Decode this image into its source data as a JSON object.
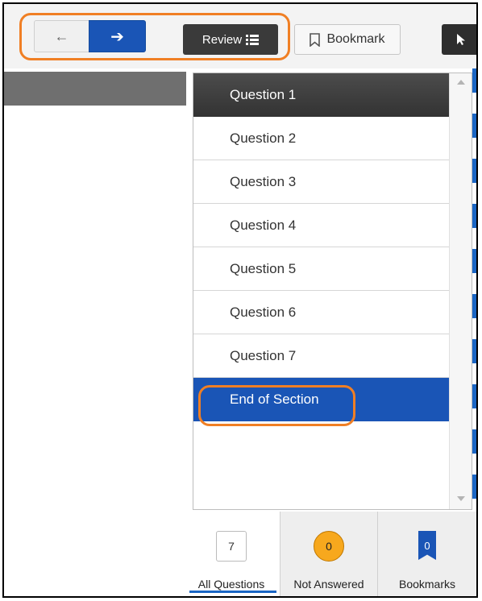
{
  "toolbar": {
    "back_icon": "arrow-left-icon",
    "next_icon": "arrow-right-icon",
    "review_label": "Review",
    "review_icon": "list-icon",
    "bookmark_label": "Bookmark",
    "bookmark_icon": "bookmark-outline-icon",
    "pointer_icon": "cursor-arrow-icon"
  },
  "review_panel": {
    "questions": [
      {
        "label": "Question 1",
        "state": "current"
      },
      {
        "label": "Question 2",
        "state": "normal"
      },
      {
        "label": "Question 3",
        "state": "normal"
      },
      {
        "label": "Question 4",
        "state": "normal"
      },
      {
        "label": "Question 5",
        "state": "normal"
      },
      {
        "label": "Question 6",
        "state": "normal"
      },
      {
        "label": "Question 7",
        "state": "normal"
      },
      {
        "label": "End of Section",
        "state": "selected"
      }
    ]
  },
  "filter_tabs": [
    {
      "label": "All Questions",
      "count": "7",
      "selected": true
    },
    {
      "label": "Not Answered",
      "count": "0",
      "selected": false
    },
    {
      "label": "Bookmarks",
      "count": "0",
      "selected": false
    }
  ],
  "colors": {
    "accent": "#1a55b6",
    "highlight": "#f07f24",
    "current_row": "#3a3a3a",
    "not_answered_badge": "#f7a81d"
  }
}
